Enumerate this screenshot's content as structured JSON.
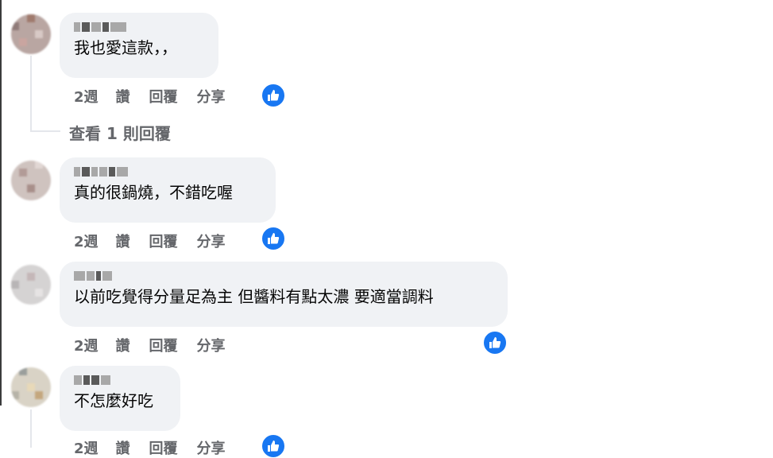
{
  "colors": {
    "bubble": "#f0f2f5",
    "secondary_text": "#65676b",
    "like_blue": "#1877f2"
  },
  "view_replies_label": "查看 1 則回覆",
  "comments": [
    {
      "text": "我也愛這款，，",
      "time": "2週",
      "like_label": "讚",
      "reply_label": "回覆",
      "share_label": "分享",
      "reaction_icon": "thumbs-up-icon"
    },
    {
      "text": "真的很鍋燒，不錯吃喔",
      "time": "2週",
      "like_label": "讚",
      "reply_label": "回覆",
      "share_label": "分享",
      "reaction_icon": "thumbs-up-icon"
    },
    {
      "text": "以前吃覺得分量足為主 但醬料有點太濃 要適當調料",
      "time": "2週",
      "like_label": "讚",
      "reply_label": "回覆",
      "share_label": "分享",
      "reaction_icon": "thumbs-up-icon"
    },
    {
      "text": "不怎麼好吃",
      "time": "2週",
      "like_label": "讚",
      "reply_label": "回覆",
      "share_label": "分享",
      "reaction_icon": "thumbs-up-icon"
    }
  ]
}
